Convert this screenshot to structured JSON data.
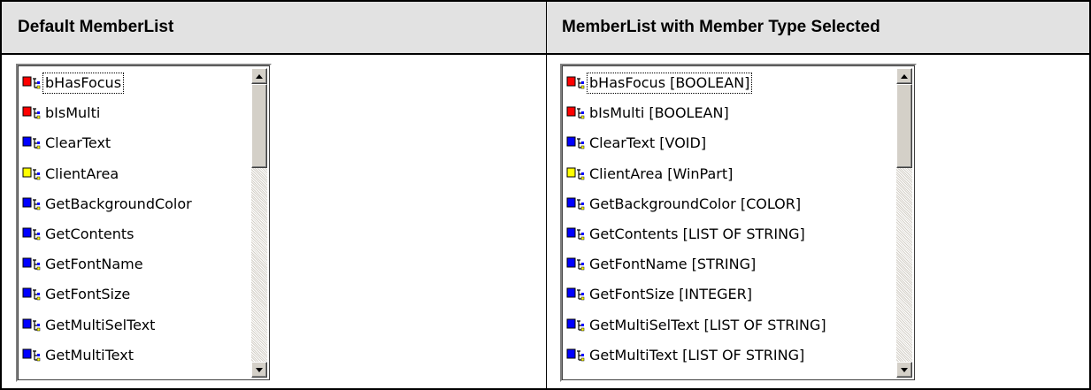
{
  "headers": {
    "left": "Default MemberList",
    "right": "MemberList with Member Type Selected"
  },
  "colors": {
    "property_red": "#ff0000",
    "method_blue": "#0000ff",
    "object_yellow": "#ffff00",
    "header_bg": "#e2e2e2",
    "border": "#000000"
  },
  "left_list": {
    "items": [
      {
        "label": "bHasFocus",
        "icon": "property-icon",
        "color": "#ff0000",
        "focused": true
      },
      {
        "label": "bIsMulti",
        "icon": "property-icon",
        "color": "#ff0000"
      },
      {
        "label": "ClearText",
        "icon": "method-icon",
        "color": "#0000ff"
      },
      {
        "label": "ClientArea",
        "icon": "object-icon",
        "color": "#ffff00"
      },
      {
        "label": "GetBackgroundColor",
        "icon": "method-icon",
        "color": "#0000ff"
      },
      {
        "label": "GetContents",
        "icon": "method-icon",
        "color": "#0000ff"
      },
      {
        "label": "GetFontName",
        "icon": "method-icon",
        "color": "#0000ff"
      },
      {
        "label": "GetFontSize",
        "icon": "method-icon",
        "color": "#0000ff"
      },
      {
        "label": "GetMultiSelText",
        "icon": "method-icon",
        "color": "#0000ff"
      },
      {
        "label": "GetMultiText",
        "icon": "method-icon",
        "color": "#0000ff"
      }
    ]
  },
  "right_list": {
    "items": [
      {
        "label": "bHasFocus [BOOLEAN]",
        "icon": "property-icon",
        "color": "#ff0000",
        "focused": true
      },
      {
        "label": "bIsMulti [BOOLEAN]",
        "icon": "property-icon",
        "color": "#ff0000"
      },
      {
        "label": "ClearText [VOID]",
        "icon": "method-icon",
        "color": "#0000ff"
      },
      {
        "label": "ClientArea [WinPart]",
        "icon": "object-icon",
        "color": "#ffff00"
      },
      {
        "label": "GetBackgroundColor [COLOR]",
        "icon": "method-icon",
        "color": "#0000ff"
      },
      {
        "label": "GetContents [LIST OF STRING]",
        "icon": "method-icon",
        "color": "#0000ff"
      },
      {
        "label": "GetFontName [STRING]",
        "icon": "method-icon",
        "color": "#0000ff"
      },
      {
        "label": "GetFontSize [INTEGER]",
        "icon": "method-icon",
        "color": "#0000ff"
      },
      {
        "label": "GetMultiSelText [LIST OF STRING]",
        "icon": "method-icon",
        "color": "#0000ff"
      },
      {
        "label": "GetMultiText [LIST OF STRING]",
        "icon": "method-icon",
        "color": "#0000ff"
      }
    ]
  },
  "scrollbar": {
    "up_icon": "arrow-up-icon",
    "down_icon": "arrow-down-icon",
    "position_fraction": 0.0
  }
}
